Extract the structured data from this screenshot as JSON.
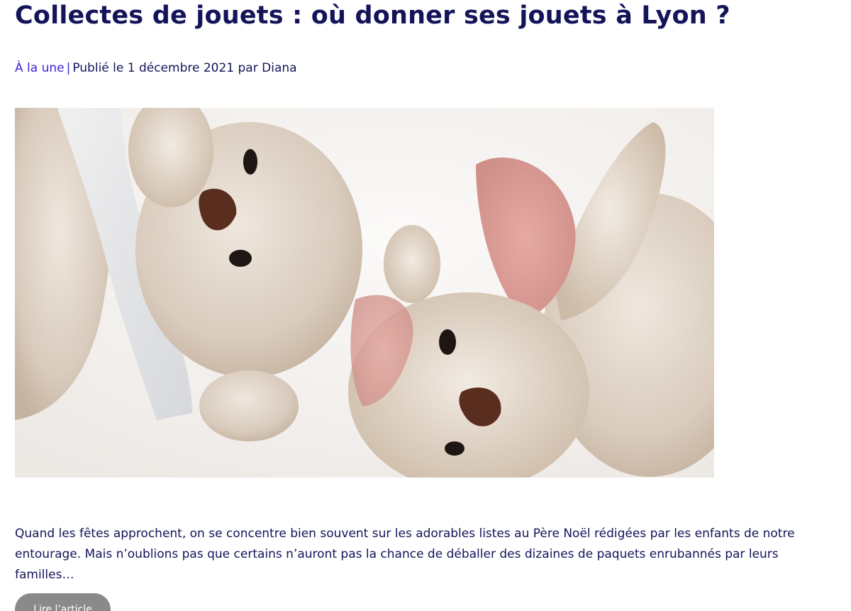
{
  "article": {
    "title": "Collectes de jouets : où donner ses jouets à Lyon ?",
    "category": "À la une",
    "separator": "|",
    "published_label": "Publié le 1 décembre 2021 par",
    "author": "Diana",
    "hero_image": "Deux peluches de lapins beiges posées sur un fond blanc",
    "excerpt": "Quand les fêtes approchent, on se concentre bien souvent sur les adorables listes au Père Noël rédigées par les enfants de notre entourage. Mais n’oublions pas que certains n’auront pas la chance de déballer des dizaines de paquets enrubannés par leurs familles…",
    "read_more": "Lire l’article"
  },
  "colors": {
    "title": "#14145a",
    "link": "#3a22d8",
    "button": "#8a8a8a"
  }
}
